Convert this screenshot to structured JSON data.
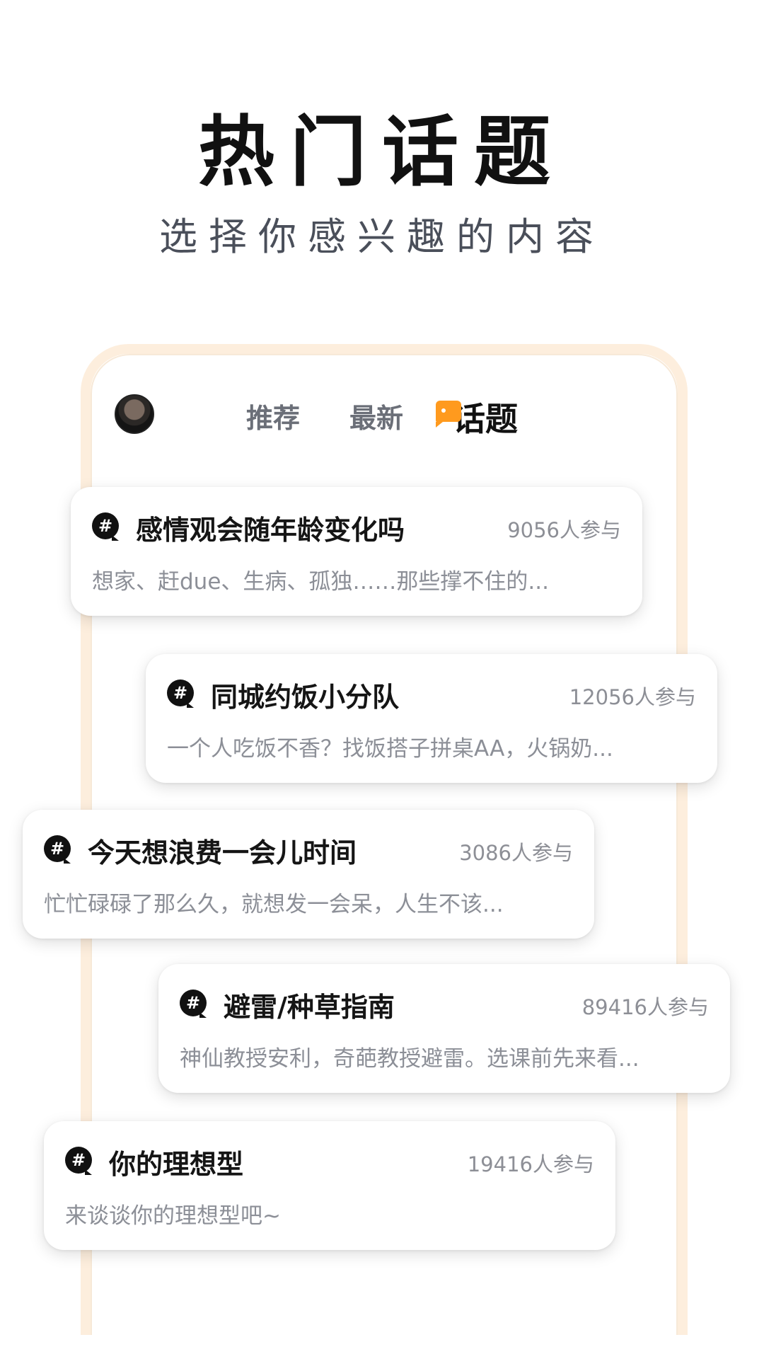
{
  "headline": "热门话题",
  "subheadline": "选择你感兴趣的内容",
  "tabs": [
    {
      "label": "推荐"
    },
    {
      "label": "最新"
    },
    {
      "label": "话题"
    }
  ],
  "active_tab": "话题",
  "topics": [
    {
      "title": "感情观会随年龄变化吗",
      "count": "9056人参与",
      "desc": "想家、赶due、生病、孤独……那些撑不住的..."
    },
    {
      "title": "同城约饭小分队",
      "count": "12056人参与",
      "desc": "一个人吃饭不香？找饭搭子拼桌AA，火锅奶..."
    },
    {
      "title": "今天想浪费一会儿时间",
      "count": "3086人参与",
      "desc": "忙忙碌碌了那么久，就想发一会呆，人生不该..."
    },
    {
      "title": "避雷/种草指南",
      "count": "89416人参与",
      "desc": "神仙教授安利，奇葩教授避雷。选课前先来看..."
    },
    {
      "title": "你的理想型",
      "count": "19416人参与",
      "desc": "来谈谈你的理想型吧~"
    }
  ],
  "icons": {
    "topic": "hashtag-bubble-icon",
    "tab_active": "chat-bubble-icon",
    "avatar": "user-avatar"
  },
  "colors": {
    "accent": "#ff9a1e",
    "frame": "#fdeedd",
    "text_primary": "#151515",
    "text_secondary": "#8c8f97"
  }
}
